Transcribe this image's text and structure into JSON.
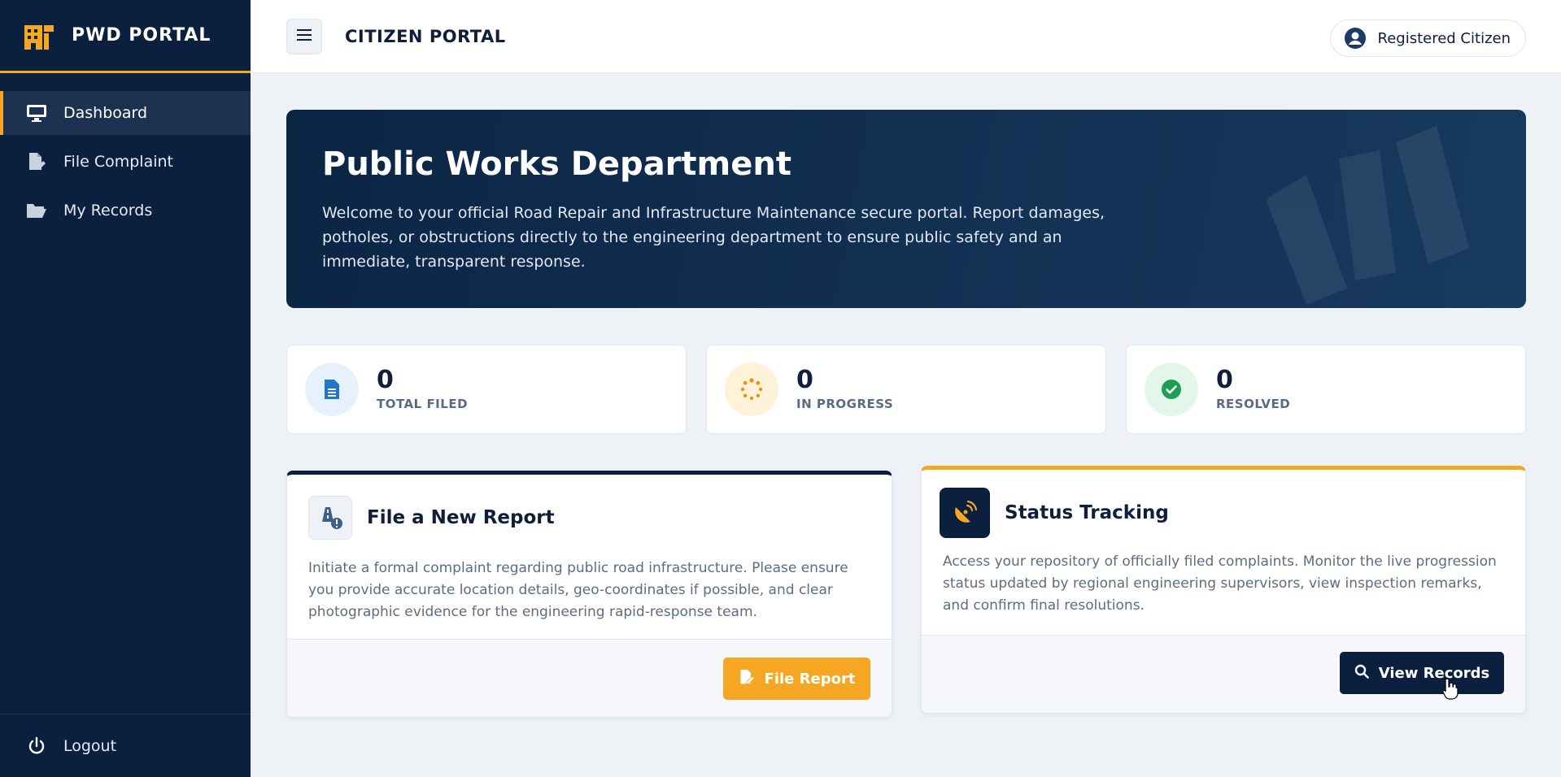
{
  "brand": {
    "name": "PWD PORTAL",
    "accent": "#f5a623"
  },
  "sidebar": {
    "items": [
      {
        "label": "Dashboard",
        "icon": "monitor-icon",
        "active": true
      },
      {
        "label": "File Complaint",
        "icon": "file-pen-icon",
        "active": false
      },
      {
        "label": "My Records",
        "icon": "folder-open-icon",
        "active": false
      }
    ],
    "logout_label": "Logout"
  },
  "topbar": {
    "title": "CITIZEN PORTAL",
    "user_label": "Registered Citizen"
  },
  "hero": {
    "title": "Public Works Department",
    "text": "Welcome to your official Road Repair and Infrastructure Maintenance secure portal. Report damages, potholes, or obstructions directly to the engineering department to ensure public safety and an immediate, transparent response."
  },
  "stats": [
    {
      "value": "0",
      "label": "TOTAL FILED",
      "icon": "file-icon",
      "color": "#1e78c8"
    },
    {
      "value": "0",
      "label": "IN PROGRESS",
      "icon": "spinner-icon",
      "color": "#e8930c"
    },
    {
      "value": "0",
      "label": "RESOLVED",
      "icon": "check-circle-icon",
      "color": "#1f9d55"
    }
  ],
  "cards": {
    "report": {
      "title": "File a New Report",
      "description": "Initiate a formal complaint regarding public road infrastructure. Please ensure you provide accurate location details, geo-coordinates if possible, and clear photographic evidence for the engineering rapid-response team.",
      "button_label": "File Report",
      "icon": "road-alert-icon"
    },
    "tracking": {
      "title": "Status Tracking",
      "description": "Access your repository of officially filed complaints. Monitor the live progression status updated by regional engineering supervisors, view inspection remarks, and confirm final resolutions.",
      "button_label": "View Records",
      "icon": "satellite-dish-icon"
    }
  }
}
